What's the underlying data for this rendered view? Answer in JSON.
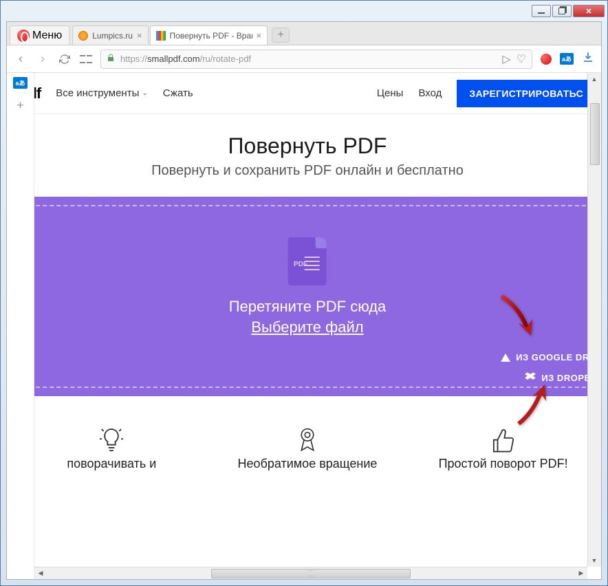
{
  "browser": {
    "menu_label": "Меню",
    "tabs": [
      {
        "title": "Lumpics.ru"
      },
      {
        "title": "Повернуть PDF - Вращат"
      }
    ],
    "new_tab": "+",
    "url_scheme": "https://",
    "url_domain": "smallpdf.com",
    "url_path": "/ru/rotate-pdf"
  },
  "sidebar": {
    "translate_badge": "a",
    "plus": "+"
  },
  "header": {
    "logo": "pdf",
    "nav_tools": "Все инструменты",
    "nav_compress": "Сжать",
    "nav_pricing": "Цены",
    "nav_login": "Вход",
    "register": "ЗАРЕГИСТРИРОВАТЬС"
  },
  "hero": {
    "title": "Повернуть PDF",
    "subtitle": "Повернуть и сохранить PDF онлайн и бесплатно"
  },
  "dropzone": {
    "drag_text": "Перетяните PDF сюда",
    "choose_text": "Выберите файл",
    "gdrive": "ИЗ GOOGLE DRIV",
    "dropbox": "ИЗ DROPBO",
    "pdf_badge": "PDF"
  },
  "features": [
    {
      "title": "поворачивать и"
    },
    {
      "title": "Необратимое вращение"
    },
    {
      "title": "Простой поворот PDF!"
    }
  ],
  "colors": {
    "accent": "#0050ef",
    "drop_bg": "#8e68e0"
  }
}
